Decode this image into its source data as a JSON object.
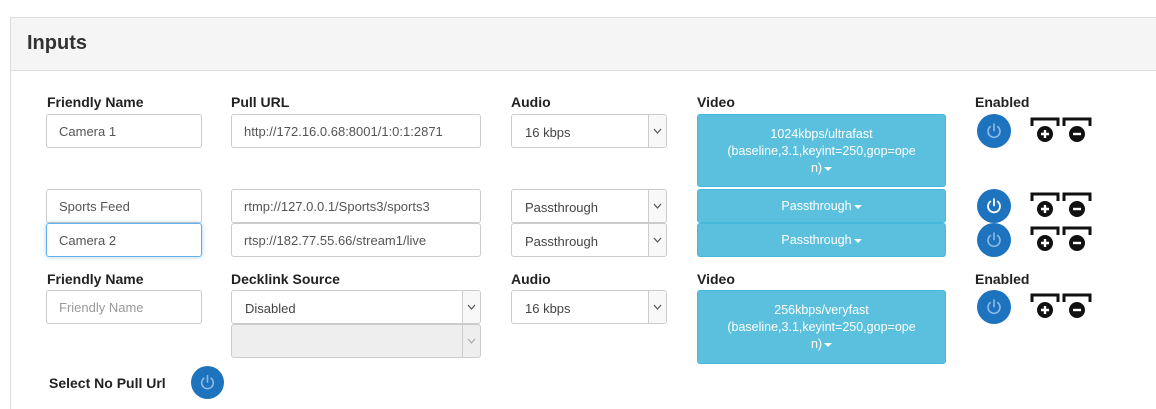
{
  "panel": {
    "title": "Inputs"
  },
  "headers": {
    "friendly_name": "Friendly Name",
    "pull_url": "Pull URL",
    "audio": "Audio",
    "video": "Video",
    "enabled": "Enabled"
  },
  "rows": [
    {
      "name": "Camera 1",
      "url": "http://172.16.0.68:8001/1:0:1:2871",
      "audio": "16 kbps",
      "video_lines": [
        "1024kbps/ultrafast",
        "(baseline,3.1,keyint=250,gop=ope",
        "n)"
      ],
      "enabled": false
    },
    {
      "name": "Sports Feed",
      "url": "rtmp://127.0.0.1/Sports3/sports3",
      "audio": "Passthrough",
      "video": "Passthrough",
      "enabled": true
    },
    {
      "name": "Camera 2",
      "url": "rtsp://182.77.55.66/stream1/live",
      "audio": "Passthrough",
      "video": "Passthrough",
      "enabled": false
    }
  ],
  "new_row": {
    "headers": {
      "friendly_name": "Friendly Name",
      "decklink_source": "Decklink Source",
      "audio": "Audio",
      "video": "Video",
      "enabled": "Enabled"
    },
    "name_placeholder": "Friendly Name",
    "decklink": "Disabled",
    "decklink_sub": "",
    "audio": "16 kbps",
    "video_lines": [
      "256kbps/veryfast",
      "(baseline,3.1,keyint=250,gop=ope",
      "n)"
    ],
    "enabled": false
  },
  "select_no_pull_url": {
    "label": "Select No Pull Url",
    "enabled": false
  },
  "icons": {
    "power": "power-icon",
    "add": "add-input-icon",
    "remove": "remove-input-icon",
    "dropdown": "chevron-down-icon"
  },
  "colors": {
    "power_on": "#1e73be",
    "video_button": "#5bc0de",
    "heading_bg": "#f5f5f5"
  }
}
